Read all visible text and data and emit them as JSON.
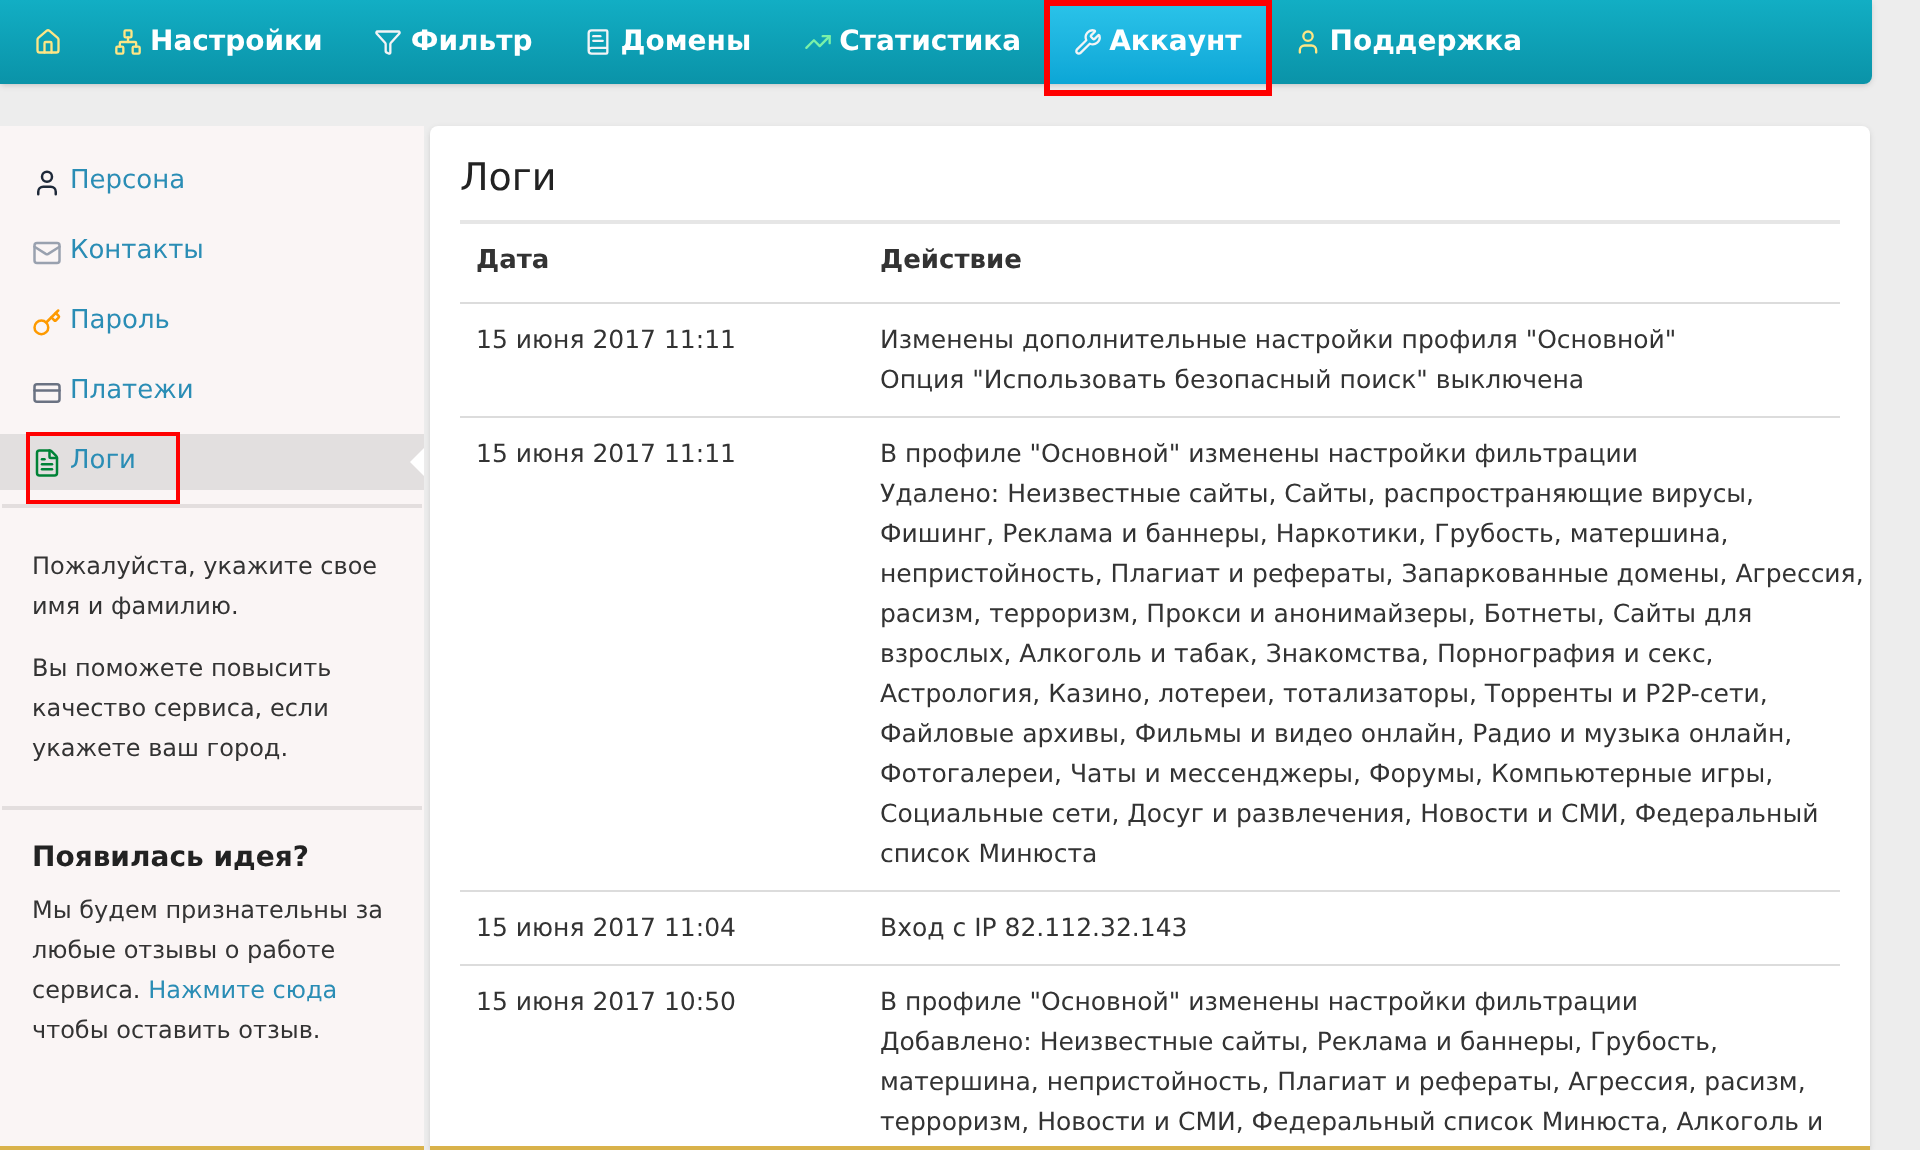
{
  "nav": [
    {
      "kind": "home",
      "selected": false
    },
    {
      "kind": "settings",
      "label": "Настройки",
      "selected": false
    },
    {
      "kind": "filter",
      "label": "Фильтр",
      "selected": false
    },
    {
      "kind": "domains",
      "label": "Домены",
      "selected": false
    },
    {
      "kind": "stats",
      "label": "Статистика",
      "selected": false
    },
    {
      "kind": "account",
      "label": "Аккаунт",
      "selected": true,
      "highlighted": true
    },
    {
      "kind": "support",
      "label": "Поддержка",
      "selected": false
    }
  ],
  "sidebar": {
    "items": [
      {
        "kind": "person",
        "label": "Персона",
        "selected": false
      },
      {
        "kind": "mail",
        "label": "Контакты",
        "selected": false
      },
      {
        "kind": "key",
        "label": "Пароль",
        "selected": false
      },
      {
        "kind": "payments",
        "label": "Платежи",
        "selected": false
      },
      {
        "kind": "logs",
        "label": "Логи",
        "selected": true,
        "highlighted": true
      }
    ],
    "notes": [
      "Пожалуйста, укажите свое имя и фамилию.",
      "Вы поможете повысить качество сервиса, если укажете ваш город."
    ],
    "idea": {
      "title": "Появилась идея?",
      "text_before": "Мы будем признательны за любые отзывы о работе сервиса.",
      "link": "Нажмите сюда",
      "text_after": "чтобы оставить отзыв."
    }
  },
  "logs": {
    "title": "Логи",
    "columns": [
      "Дата",
      "Действие"
    ],
    "rows": [
      {
        "date": "15 июня 2017 11:11",
        "lines": [
          "Изменены дополнительные настройки профиля \"Основной\"",
          "Опция \"Использовать безопасный поиск\" выключена"
        ]
      },
      {
        "date": "15 июня 2017 11:11",
        "lines": [
          "В профиле \"Основной\" изменены настройки фильтрации",
          "Удалено: Неизвестные сайты, Сайты, распространяющие вирусы,",
          "Фишинг, Реклама и баннеры, Наркотики, Грубость, матершина,",
          "непристойность, Плагиат и рефераты, Запаркованные домены, Агрессия,",
          "расизм, терроризм, Прокси и анонимайзеры, Ботнеты, Сайты для",
          "взрослых, Алкоголь и табак, Знакомства, Порнография и секс,",
          "Астрология, Казино, лотереи, тотализаторы, Торренты и P2P-сети,",
          "Файловые архивы, Фильмы и видео онлайн, Радио и музыка онлайн,",
          "Фотогалереи, Чаты и мессенджеры, Форумы, Компьютерные игры,",
          "Социальные сети, Досуг и развлечения, Новости и СМИ, Федеральный",
          "список Минюста"
        ]
      },
      {
        "date": "15 июня 2017 11:04",
        "lines": [
          "Вход с IP 82.112.32.143"
        ]
      },
      {
        "date": "15 июня 2017 10:50",
        "lines": [
          "В профиле \"Основной\" изменены настройки фильтрации",
          "Добавлено: Неизвестные сайты, Реклама и баннеры, Грубость,",
          "матершина, непристойность, Плагиат и рефераты, Агрессия, расизм,",
          "терроризм, Новости и СМИ, Федеральный список Минюста, Алкоголь и"
        ]
      }
    ]
  }
}
